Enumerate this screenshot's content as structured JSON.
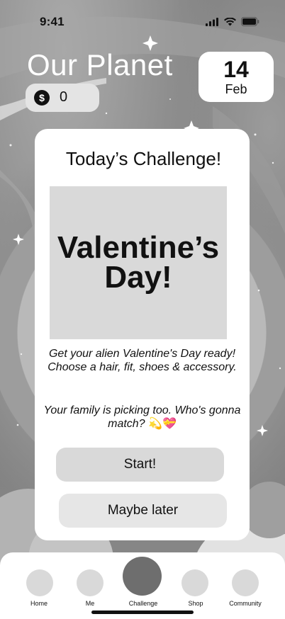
{
  "status_bar": {
    "time": "9:41",
    "icons": [
      "cellular-signal-icon",
      "wifi-icon",
      "battery-icon"
    ]
  },
  "header": {
    "title": "Our Planet",
    "coins": {
      "icon": "dollar-coin-icon",
      "symbol": "$",
      "count": "0"
    },
    "date": {
      "day": "14",
      "month": "Feb"
    }
  },
  "challenge": {
    "title": "Today’s Challenge!",
    "image_text": "Valentine’s Day!",
    "description": "Get your alien Valentine's Day ready! Choose a hair, fit, shoes & accessory.",
    "description_2": "Your family is picking too. Who's gonna match?",
    "emojis": "💫💝",
    "start_label": "Start!",
    "later_label": "Maybe later"
  },
  "nav": {
    "items": [
      {
        "label": "Home"
      },
      {
        "label": "Me"
      },
      {
        "label": "Challenge",
        "active": true
      },
      {
        "label": "Shop"
      },
      {
        "label": "Community"
      }
    ]
  },
  "colors": {
    "background": "#8a8a8a",
    "card": "#ffffff",
    "button_primary": "#d9d9d9",
    "button_secondary": "#e6e6e6",
    "nav_active": "#6e6e6e",
    "nav_inactive": "#d9d9d9"
  }
}
